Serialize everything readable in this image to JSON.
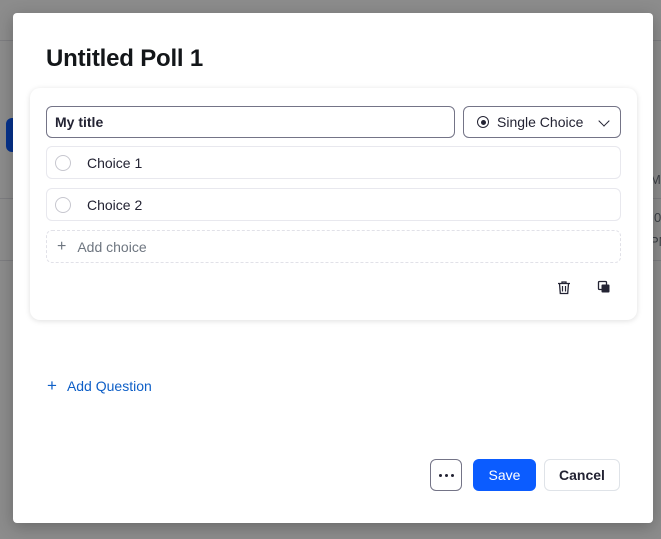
{
  "modal": {
    "title": "Untitled Poll 1"
  },
  "question": {
    "title_value": "My title",
    "type_label": "Single Choice",
    "choices": [
      {
        "label": "Choice 1"
      },
      {
        "label": "Choice 2"
      }
    ],
    "add_choice_label": "Add choice"
  },
  "add_question_label": "Add Question",
  "footer": {
    "save_label": "Save",
    "cancel_label": "Cancel"
  },
  "colors": {
    "accent": "#0b5cff",
    "link": "#0e5fc7"
  },
  "background_fragments": {
    "frag1": "Me",
    "frag2": "0",
    "frag3": "PN"
  }
}
